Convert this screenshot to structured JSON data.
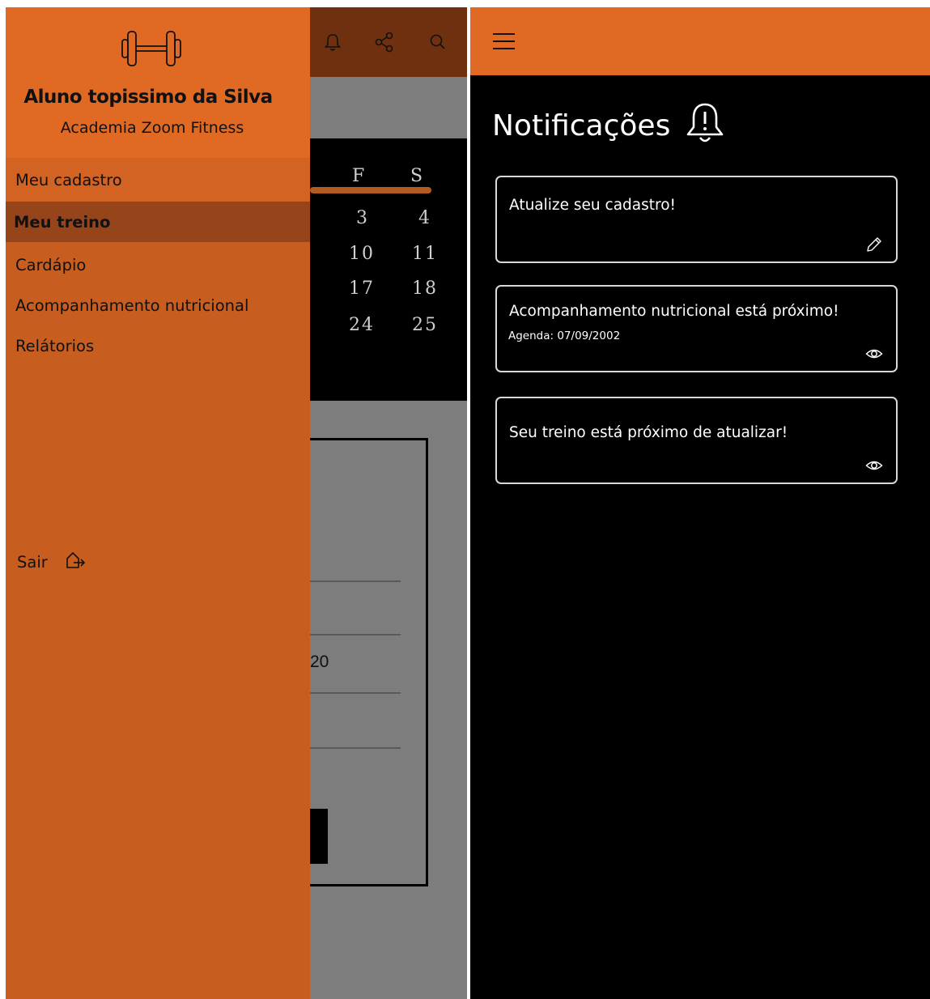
{
  "left_screen": {
    "drawer": {
      "logo_icon": "dumbbell-icon",
      "user_name": "Aluno topissimo da Silva",
      "gym_name": "Academia Zoom Fitness",
      "menu": [
        {
          "label": "Meu cadastro",
          "state": "hover"
        },
        {
          "label": "Meu treino",
          "state": "selected"
        },
        {
          "label": "Cardápio",
          "state": "normal"
        },
        {
          "label": "Acompanhamento nutricional",
          "state": "normal"
        },
        {
          "label": "Relátorios",
          "state": "normal"
        }
      ],
      "logout_label": "Sair",
      "logout_icon": "logout-icon"
    },
    "background": {
      "topbar_icons": [
        "bell-icon",
        "share-icon",
        "search-icon"
      ],
      "calendar": {
        "headers": [
          "F",
          "S"
        ],
        "rows": [
          [
            "3",
            "4"
          ],
          [
            "10",
            "11"
          ],
          [
            "17",
            "18"
          ],
          [
            "24",
            "25"
          ]
        ]
      },
      "partial_value": "20"
    }
  },
  "right_screen": {
    "appbar": {
      "menu_icon": "hamburger-icon"
    },
    "title": "Notificações",
    "title_icon": "bell-alert-icon",
    "notifications": [
      {
        "message": "Atualize seu cadastro!",
        "detail": "",
        "action_icon": "pencil-icon"
      },
      {
        "message": "Acompanhamento nutricional está próximo!",
        "detail": "Agenda: 07/09/2002",
        "action_icon": "eye-icon"
      },
      {
        "message": "Seu treino está próximo de atualizar!",
        "detail": "",
        "action_icon": "eye-icon"
      }
    ]
  },
  "colors": {
    "accent_orange": "#e06a24",
    "drawer_orange": "#c75d1e",
    "selected_brown": "#96441a",
    "background_black": "#000000"
  }
}
